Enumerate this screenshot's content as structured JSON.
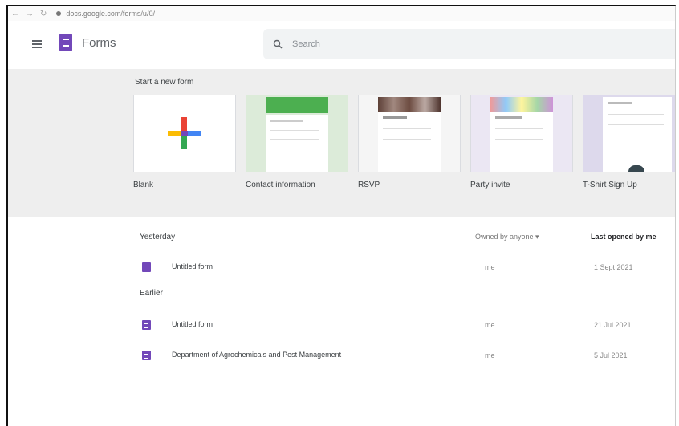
{
  "browser": {
    "url": "docs.google.com/forms/u/0/"
  },
  "header": {
    "app_title": "Forms",
    "search_placeholder": "Search"
  },
  "templates": {
    "section_label": "Start a new form",
    "items": [
      {
        "label": "Blank"
      },
      {
        "label": "Contact information"
      },
      {
        "label": "RSVP"
      },
      {
        "label": "Party invite"
      },
      {
        "label": "T-Shirt Sign Up"
      }
    ]
  },
  "list": {
    "owner_filter": "Owned by anyone ▾",
    "sort_label": "Last opened by me",
    "groups": [
      {
        "title": "Yesterday",
        "rows": [
          {
            "title": "Untitled form",
            "owner": "me",
            "date": "1 Sept 2021"
          }
        ]
      },
      {
        "title": "Earlier",
        "rows": [
          {
            "title": "Untitled form",
            "owner": "me",
            "date": "21 Jul 2021"
          },
          {
            "title": "Department of Agrochemicals and Pest Management",
            "owner": "me",
            "date": "5 Jul 2021"
          }
        ]
      }
    ]
  },
  "colors": {
    "forms_purple": "#7248b9",
    "template_band": "#eeeeee",
    "search_bg": "#f1f3f4"
  }
}
